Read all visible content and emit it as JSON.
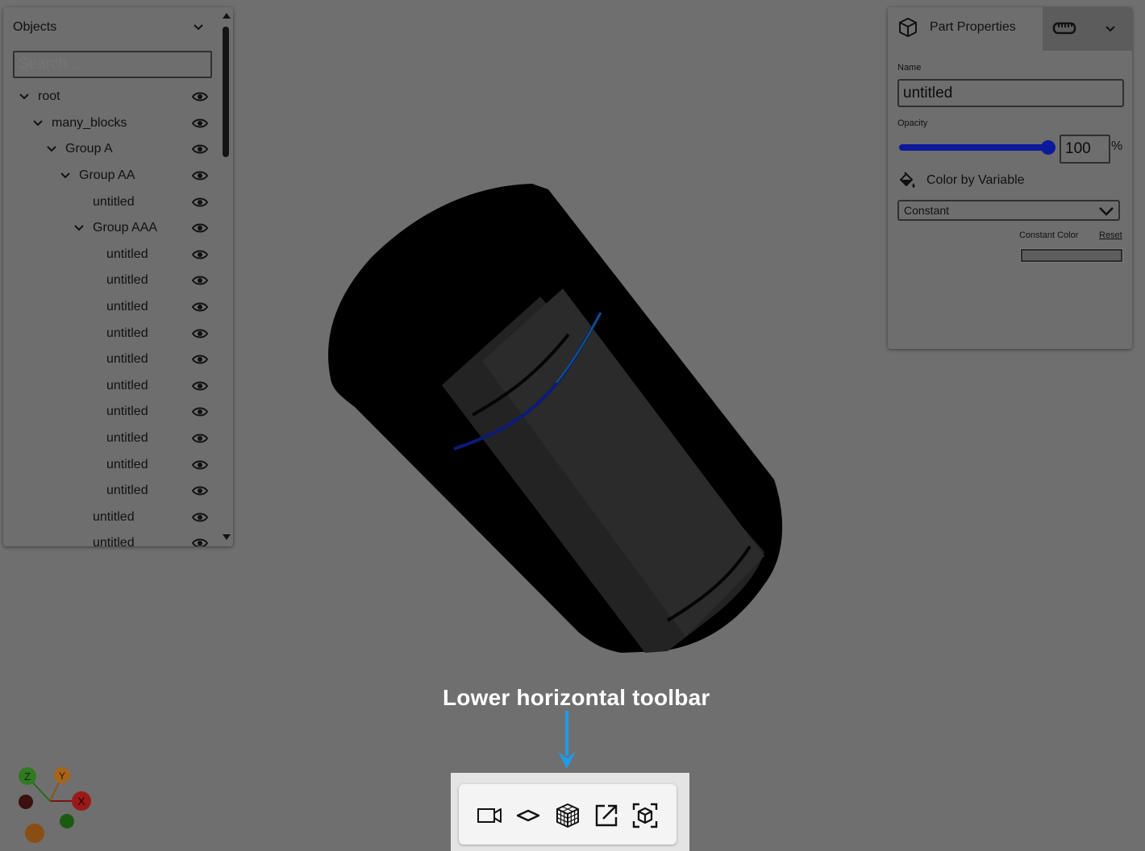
{
  "objects_panel": {
    "title": "Objects",
    "search_placeholder": "Search...",
    "tree": [
      {
        "label": "root",
        "depth": 0,
        "expandable": true
      },
      {
        "label": "many_blocks",
        "depth": 1,
        "expandable": true
      },
      {
        "label": "Group A",
        "depth": 2,
        "expandable": true
      },
      {
        "label": "Group AA",
        "depth": 3,
        "expandable": true
      },
      {
        "label": "untitled",
        "depth": 4,
        "expandable": false
      },
      {
        "label": "Group AAA",
        "depth": 4,
        "expandable": true
      },
      {
        "label": "untitled",
        "depth": 5,
        "expandable": false
      },
      {
        "label": "untitled",
        "depth": 5,
        "expandable": false
      },
      {
        "label": "untitled",
        "depth": 5,
        "expandable": false
      },
      {
        "label": "untitled",
        "depth": 5,
        "expandable": false
      },
      {
        "label": "untitled",
        "depth": 5,
        "expandable": false
      },
      {
        "label": "untitled",
        "depth": 5,
        "expandable": false
      },
      {
        "label": "untitled",
        "depth": 5,
        "expandable": false
      },
      {
        "label": "untitled",
        "depth": 5,
        "expandable": false
      },
      {
        "label": "untitled",
        "depth": 5,
        "expandable": false
      },
      {
        "label": "untitled",
        "depth": 5,
        "expandable": false
      },
      {
        "label": "untitled",
        "depth": 4,
        "expandable": false
      },
      {
        "label": "untitled",
        "depth": 4,
        "expandable": false
      }
    ]
  },
  "properties_panel": {
    "title": "Part Properties",
    "name_label": "Name",
    "name_value": "untitled",
    "opacity_label": "Opacity",
    "opacity_value": "100",
    "opacity_fraction": 1.0,
    "percent_sign": "%",
    "color_by_label": "Color by Variable",
    "color_by_value": "Constant",
    "constant_color_label": "Constant Color",
    "reset_label": "Reset",
    "constant_color": "#5e5e5e"
  },
  "annotation": {
    "text": "Lower horizontal toolbar"
  },
  "toolbar": {
    "buttons": [
      {
        "name": "camera-button",
        "icon": "video-camera-icon"
      },
      {
        "name": "plane-button",
        "icon": "plane-icon"
      },
      {
        "name": "mesh-button",
        "icon": "grid-cube-icon"
      },
      {
        "name": "export-button",
        "icon": "external-link-icon"
      },
      {
        "name": "focus-button",
        "icon": "focus-cube-icon"
      }
    ]
  },
  "axes": {
    "x_label": "X",
    "y_label": "Y",
    "z_label": "Z",
    "x_color": "#9a1a1a",
    "y_color": "#a8641a",
    "z_color": "#2f7a22"
  },
  "colors": {
    "background": "#6f6f6f",
    "accent": "#0c1a9a",
    "arrow": "#1e9bea"
  }
}
